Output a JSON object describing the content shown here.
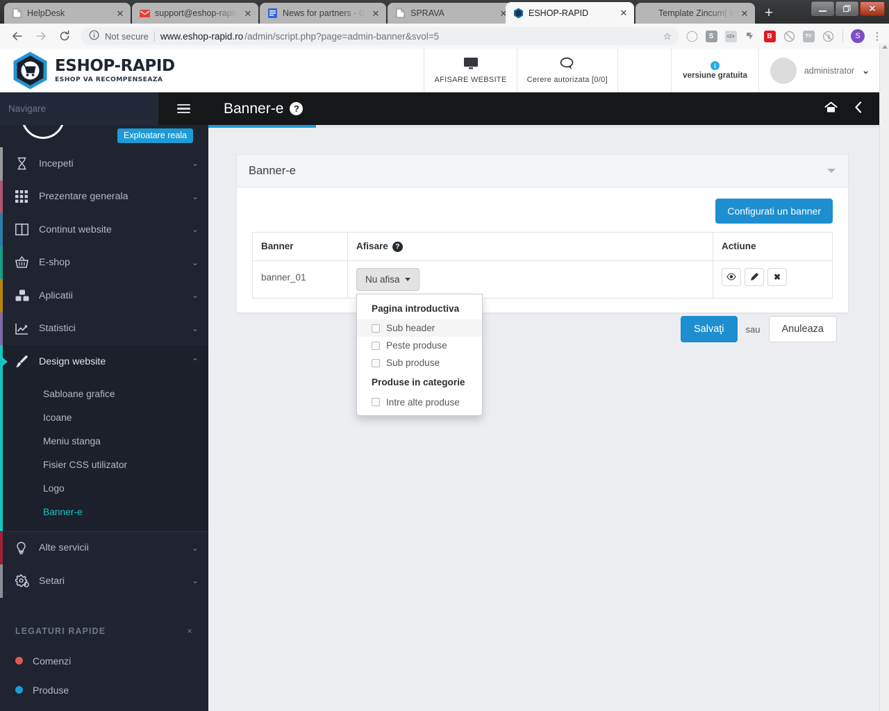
{
  "browser": {
    "tabs": [
      {
        "title": "HelpDesk",
        "favicon": "page-icon",
        "active": false
      },
      {
        "title": "support@eshop-rapic",
        "favicon": "gmail-icon",
        "active": false
      },
      {
        "title": "News for partners - G",
        "favicon": "news-icon",
        "active": false
      },
      {
        "title": "SPRAVA",
        "favicon": "page-icon",
        "active": false
      },
      {
        "title": "ESHOP-RAPID",
        "favicon": "eshop-rapid-icon",
        "active": true
      },
      {
        "title": "Template Zincum| We",
        "favicon": "none",
        "active": false
      }
    ],
    "new_tab_label": "+",
    "window_controls": {
      "minimize": "—",
      "maximize": "❐",
      "close": "✕"
    },
    "toolbar": {
      "back": "←",
      "forward": "→",
      "reload": "↻",
      "security_label": "Not secure",
      "url_main": "www.eshop-rapid.ro",
      "url_rest": "/admin/script.php?page=admin-banner&svol=5",
      "bookmark_star": "☆",
      "extensions": [
        {
          "name": "colorpick-icon",
          "glyph": "(··)"
        },
        {
          "name": "script-icon",
          "glyph": "S"
        },
        {
          "name": "code-icon",
          "glyph": "</>"
        },
        {
          "name": "pin-icon",
          "glyph": "⤡"
        },
        {
          "name": "bitwarden-icon",
          "glyph": "B"
        },
        {
          "name": "adblock-icon",
          "glyph": "⊘"
        },
        {
          "name": "tv-icon",
          "glyph": "TV"
        },
        {
          "name": "noscript-icon",
          "glyph": "Ⓢ"
        }
      ],
      "profile_initial": "S",
      "menu_glyph": "⋮"
    }
  },
  "app_header": {
    "brand_title": "ESHOP-RAPID",
    "brand_subtitle": "ESHOP VA RECOMPENSEAZA",
    "cells": [
      {
        "name": "afisare-website",
        "icon": "monitor-icon",
        "label": "AFISARE WEBSITE"
      },
      {
        "name": "cerere-autorizata",
        "icon": "chat-icon",
        "label": "Cerere autorizata [0/0]"
      }
    ],
    "version_label": "versiune gratuita",
    "version_info_glyph": "i",
    "user_name": "administrator",
    "user_caret": "⌄"
  },
  "page_bar": {
    "title": "Banner-e",
    "help_glyph": "?",
    "home_icon": "home-icon",
    "back_icon": "chevron-left-icon",
    "progress_percent": 16
  },
  "sidebar": {
    "header_label": "Navigare",
    "burger_icon": "hamburger-icon",
    "badge_label": "Exploatare reala",
    "items": [
      {
        "label": "Incepeti",
        "icon": "hourglass-icon",
        "accent": "#9a9a9a",
        "chevron": "⌄"
      },
      {
        "label": "Prezentare generala",
        "icon": "grid-icon",
        "accent": "#b05672",
        "chevron": "⌄"
      },
      {
        "label": "Continut website",
        "icon": "columns-icon",
        "accent": "#2c7fa8",
        "chevron": "⌄"
      },
      {
        "label": "E-shop",
        "icon": "basket-icon",
        "accent": "#16a085",
        "chevron": "⌄"
      },
      {
        "label": "Aplicatii",
        "icon": "blocks-icon",
        "accent": "#b8860b",
        "chevron": "⌄"
      },
      {
        "label": "Statistici",
        "icon": "chart-line-icon",
        "accent": "#7d6ca8",
        "chevron": "⌄"
      },
      {
        "label": "Design website",
        "icon": "brush-icon",
        "accent": "#17c4c4",
        "chevron": "⌃",
        "open": true
      }
    ],
    "submenu": [
      {
        "label": "Sabloane grafice",
        "active": false
      },
      {
        "label": "Icoane",
        "active": false
      },
      {
        "label": "Meniu stanga",
        "active": false
      },
      {
        "label": "Fisier CSS utilizator",
        "active": false
      },
      {
        "label": "Logo",
        "active": false
      },
      {
        "label": "Banner-e",
        "active": true
      }
    ],
    "items_after": [
      {
        "label": "Alte servicii",
        "icon": "bulb-icon",
        "accent": "#9b2335",
        "chevron": "⌄"
      },
      {
        "label": "Setari",
        "icon": "gears-icon",
        "accent": "#8a8f96",
        "chevron": "⌄"
      }
    ],
    "quick_links": {
      "title": "LEGATURI RAPIDE",
      "close_glyph": "×",
      "items": [
        {
          "label": "Comenzi",
          "color": "#e05a52"
        },
        {
          "label": "Produse",
          "color": "#1e9ad6"
        }
      ]
    }
  },
  "main": {
    "panel_title": "Banner-e",
    "panel_caret": "caret-down-icon",
    "configure_button": "Configurati un banner",
    "table": {
      "columns": [
        "Banner",
        "Afisare",
        "Actiune"
      ],
      "afisare_help_glyph": "?",
      "rows": [
        {
          "banner": "banner_01",
          "dropdown_label": "Nu afisa",
          "actions": [
            {
              "name": "preview-button",
              "glyph": "◉"
            },
            {
              "name": "edit-button",
              "glyph": "✎"
            },
            {
              "name": "delete-button",
              "glyph": "✖"
            }
          ]
        }
      ]
    },
    "dropdown_menu": {
      "groups": [
        {
          "header": "Pagina introductiva",
          "options": [
            {
              "label": "Sub header",
              "checked": false,
              "highlighted": true
            },
            {
              "label": "Peste produse",
              "checked": false,
              "highlighted": false
            },
            {
              "label": "Sub produse",
              "checked": false,
              "highlighted": false
            }
          ]
        },
        {
          "header": "Produse in categorie",
          "options": [
            {
              "label": "Intre alte produse",
              "checked": false,
              "highlighted": false
            }
          ]
        }
      ]
    },
    "save_label": "Salvaţi",
    "or_label": "sau",
    "cancel_label": "Anuleaza"
  },
  "colors": {
    "accent_blue": "#1d8fd1",
    "sidebar_bg": "#1f2430",
    "topbar_black": "#161719",
    "active_teal": "#17c4c4",
    "page_bg": "#eceef1"
  }
}
